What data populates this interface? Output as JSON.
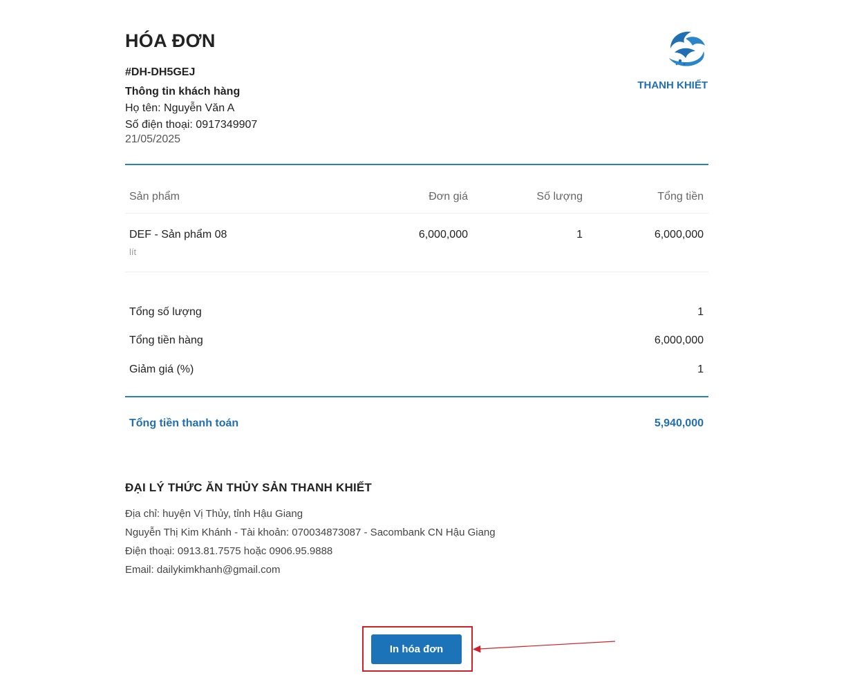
{
  "invoice": {
    "title": "HÓA ĐƠN",
    "order_code": "#DH-DH5GEJ",
    "customer_heading": "Thông tin khách hàng",
    "customer_name_line": "Họ tên: Nguyễn Văn A",
    "customer_phone_line": "Số điện thoại: 0917349907",
    "date": "21/05/2025"
  },
  "brand": {
    "name": "THANH KHIẾT",
    "logo_icon": "fish-wave-logo",
    "color": "#1f6fb2"
  },
  "table": {
    "headers": [
      "Sản phẩm",
      "Đơn giá",
      "Số lượng",
      "Tổng tiền"
    ],
    "rows": [
      {
        "product": "DEF - Sản phẩm 08",
        "unit": "lít",
        "price": "6,000,000",
        "qty": "1",
        "total": "6,000,000"
      }
    ]
  },
  "summary": {
    "total_qty_label": "Tổng số lượng",
    "total_qty": "1",
    "subtotal_label": "Tổng tiền hàng",
    "subtotal": "6,000,000",
    "discount_label": "Giảm giá (%)",
    "discount": "1",
    "grand_total_label": "Tổng tiền thanh toán",
    "grand_total": "5,940,000"
  },
  "shop": {
    "name": "ĐẠI LÝ THỨC ĂN THỦY SẢN THANH KHIẾT",
    "address": "Địa chỉ: huyện Vị Thủy, tỉnh Hậu Giang",
    "bank": "Nguyễn Thị Kim Khánh - Tài khoản: 070034873087 - Sacombank CN Hậu Giang",
    "phone": "Điện thoại: 0913.81.7575 hoặc 0906.95.9888",
    "email": "Email: dailykimkhanh@gmail.com"
  },
  "actions": {
    "print_label": "In hóa đơn",
    "button_color": "#1c73b8",
    "highlight_color": "#d0202a"
  }
}
